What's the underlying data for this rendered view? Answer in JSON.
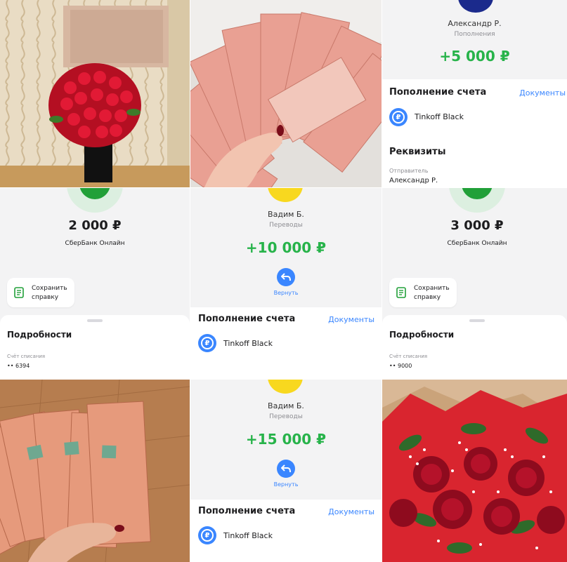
{
  "tiles": {
    "top_right": {
      "sender_name": "Александр Р.",
      "category": "Пополнения",
      "amount": "+5 000 ₽",
      "section_title": "Пополнение счета",
      "documents_link": "Документы",
      "card_name": "Tinkoff Black",
      "requisites_title": "Реквизиты",
      "sender_label": "Отправитель",
      "sender_value": "Александр Р."
    },
    "mid_left": {
      "amount": "2 000 ₽",
      "bank": "СберБанк Онлайн",
      "save_button_line1": "Сохранить",
      "save_button_line2": "справку",
      "details_title": "Подробности",
      "account_label": "Счёт списания",
      "account_value": "•• 6394"
    },
    "mid_center": {
      "sender_name": "Вадим Б.",
      "category": "Переводы",
      "amount": "+10 000 ₽",
      "return_label": "Вернуть",
      "section_title": "Пополнение счета",
      "documents_link": "Документы",
      "card_name": "Tinkoff Black"
    },
    "mid_right": {
      "amount": "3 000 ₽",
      "bank": "СберБанк Онлайн",
      "save_button_line1": "Сохранить",
      "save_button_line2": "справку",
      "details_title": "Подробности",
      "account_label": "Счёт списания",
      "account_value": "•• 9000"
    },
    "bottom_center": {
      "sender_name": "Вадим Б.",
      "category": "Переводы",
      "amount": "+15 000 ₽",
      "return_label": "Вернуть",
      "section_title": "Пополнение счета",
      "documents_link": "Документы",
      "card_name": "Tinkoff Black"
    }
  },
  "colors": {
    "green": "#27b34a",
    "blue": "#3a86ff",
    "sber_green": "#21a038",
    "yellow": "#f8d81f",
    "navy": "#1b2a8c"
  },
  "icons": [
    "ruble-icon",
    "document-icon",
    "return-arrow-icon",
    "sber-logo-icon",
    "tinkoff-logo-icon"
  ]
}
